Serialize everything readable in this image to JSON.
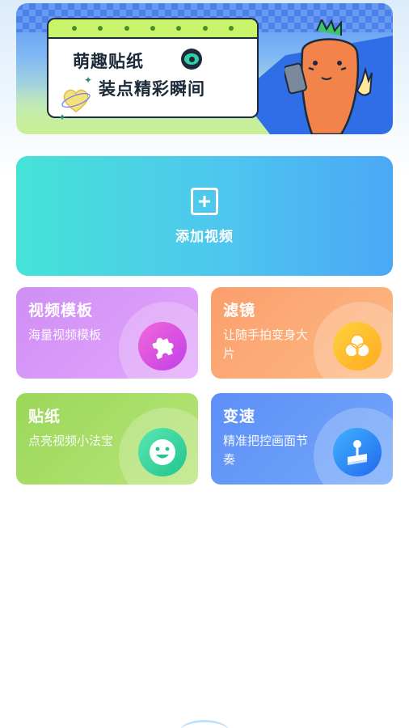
{
  "banner": {
    "line1": "萌趣贴纸",
    "line2": "装点精彩瞬间",
    "icons": [
      "eye-icon",
      "heart-icon",
      "sparkle-icon"
    ],
    "colors": {
      "board_top": "#c7f46a",
      "ink": "#1c2a3a",
      "carrot": "#f2834a"
    }
  },
  "add_video": {
    "label": "添加视频",
    "icon": "plus-icon",
    "gradient": [
      "#45e3d6",
      "#4ba8f5"
    ]
  },
  "features": [
    {
      "title": "视频模板",
      "desc": "海量视频模板",
      "icon": "puzzle-icon",
      "color": "#d99af8"
    },
    {
      "title": "滤镜",
      "desc": "让随手拍变身大片",
      "icon": "filter-circles-icon",
      "color": "#fcac78"
    },
    {
      "title": "贴纸",
      "desc": "点亮视频小法宝",
      "icon": "smiley-icon",
      "color": "#a7dd66"
    },
    {
      "title": "变速",
      "desc": "精准把控画面节奏",
      "icon": "joystick-icon",
      "color": "#6699f8"
    }
  ]
}
